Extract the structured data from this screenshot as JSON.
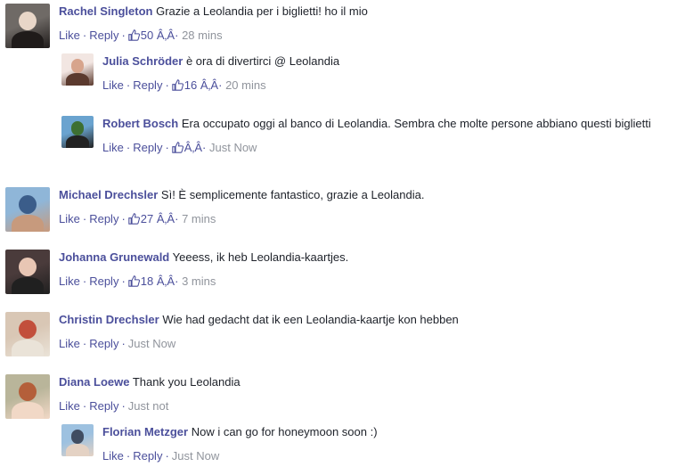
{
  "comments": [
    {
      "author": "Rachel Singleton",
      "text": "Grazie a Leolandia per i biglietti! ho il mio",
      "like": "Like",
      "reply": "Reply",
      "likes": "50 Â‚Â·",
      "time": "28 mins",
      "avatar_colors": [
        "#6f6a66",
        "#e8d6c8",
        "#1f1b1a"
      ]
    },
    {
      "author": "Julia Schröder",
      "text": "è ora di divertirci @ Leolandia",
      "like": "Like",
      "reply": "Reply",
      "likes": "16 Â‚Â·",
      "time": "20 mins",
      "avatar_colors": [
        "#f2e6e2",
        "#d7a48c",
        "#5b3a2e"
      ]
    },
    {
      "author": "Robert Bosch",
      "text": "Era occupato oggi al banco di Leolandia. Sembra che molte persone abbiano questi biglietti",
      "like": "Like",
      "reply": "Reply",
      "likes": "Â‚Â·",
      "time": "Just Now",
      "avatar_colors": [
        "#6aa3cf",
        "#3d6f32",
        "#222222"
      ]
    },
    {
      "author": "Michael Drechsler",
      "text": "Sì! È semplicemente fantastico, grazie a Leolandia.",
      "like": "Like",
      "reply": "Reply",
      "likes": "27 Â‚Â·",
      "time": "7 mins",
      "avatar_colors": [
        "#8fb6d8",
        "#3b5d8a",
        "#c79a7d"
      ]
    },
    {
      "author": "Johanna Grunewald",
      "text": "Yeeess, ik heb Leolandia-kaartjes.",
      "like": "Like",
      "reply": "Reply",
      "likes": "18 Â‚Â·",
      "time": "3 mins",
      "avatar_colors": [
        "#4a3b3b",
        "#e8c6b4",
        "#202020"
      ]
    },
    {
      "author": "Christin Drechsler",
      "text": "Wie had gedacht dat ik een Leolandia-kaartje kon hebben",
      "like": "Like",
      "reply": "Reply",
      "likes": "",
      "time": "Just Now",
      "avatar_colors": [
        "#d9c7b5",
        "#c24f3b",
        "#eae3d8"
      ]
    },
    {
      "author": "Diana Loewe",
      "text": "Thank you Leolandia",
      "like": "Like",
      "reply": "Reply",
      "likes": "",
      "time": "Just not",
      "avatar_colors": [
        "#b9b59a",
        "#b45f3a",
        "#f1d8c6"
      ]
    },
    {
      "author": "Florian Metzger",
      "text": "Now i can go for honeymoon soon :)",
      "like": "Like",
      "reply": "Reply",
      "likes": "",
      "time": "Just Now",
      "avatar_colors": [
        "#9dc1e0",
        "#404d62",
        "#e4d2c4"
      ]
    }
  ],
  "colors": {
    "link": "#4b4f9b",
    "meta": "#90949c",
    "text": "#1d2129"
  },
  "icons": {
    "like": "thumbs-up-icon"
  }
}
